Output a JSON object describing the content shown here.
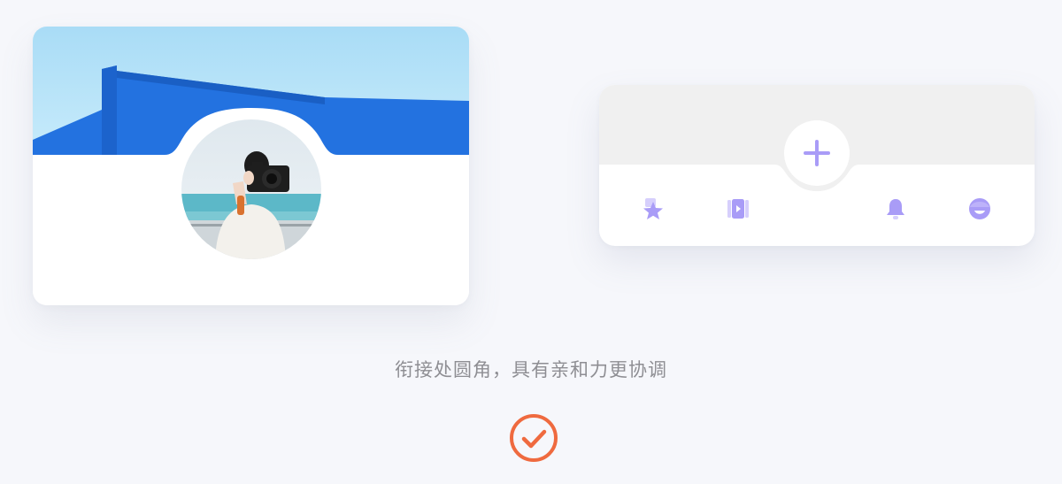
{
  "profile_card": {
    "cover_icon": "building-sky-photo",
    "avatar_icon": "person-with-camera-photo"
  },
  "tabbar": {
    "add_icon": "plus-icon",
    "items": [
      {
        "name": "favorites",
        "icon": "star-icon"
      },
      {
        "name": "video",
        "icon": "video-play-icon"
      },
      {
        "name": "notifications",
        "icon": "bell-icon"
      },
      {
        "name": "profile",
        "icon": "face-icon"
      }
    ],
    "accent_color": "#a99cf7",
    "panel_gray": "#f0f0f0"
  },
  "caption": "衔接处圆角，具有亲和力更协调",
  "status": {
    "icon": "check-circle-icon",
    "color": "#ef6a3f"
  }
}
